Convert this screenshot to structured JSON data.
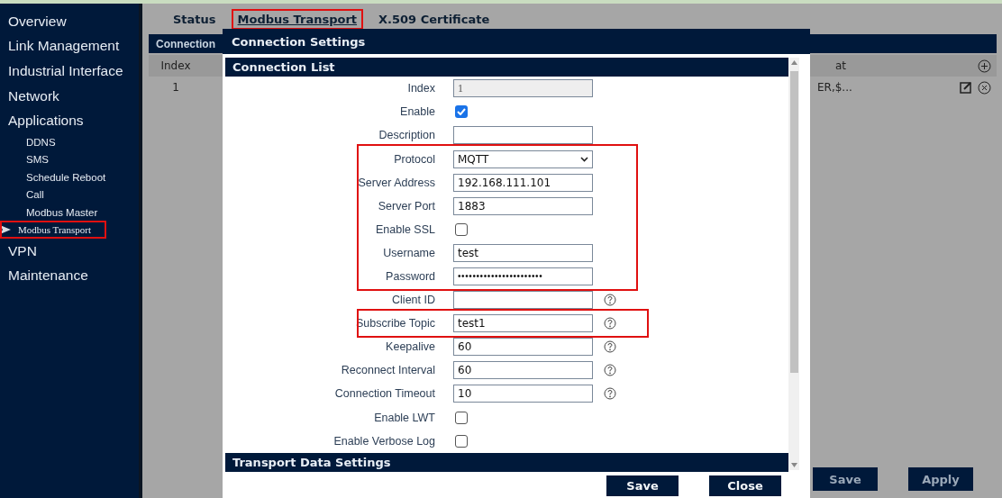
{
  "sidebar": {
    "items": [
      {
        "label": "Overview",
        "selected": false,
        "highlighted": false
      },
      {
        "label": "Link Management",
        "selected": false,
        "highlighted": false
      },
      {
        "label": "Industrial Interface",
        "selected": false,
        "highlighted": false
      },
      {
        "label": "Network",
        "selected": false,
        "highlighted": false
      },
      {
        "label": "Applications",
        "selected": false,
        "highlighted": false,
        "children": [
          {
            "label": "DDNS",
            "selected": false,
            "highlighted": false
          },
          {
            "label": "SMS",
            "selected": false,
            "highlighted": false
          },
          {
            "label": "Schedule Reboot",
            "selected": false,
            "highlighted": false
          },
          {
            "label": "Call",
            "selected": false,
            "highlighted": false
          },
          {
            "label": "Modbus Master",
            "selected": false,
            "highlighted": false
          },
          {
            "label": "Modbus Transport",
            "selected": true,
            "highlighted": true
          }
        ]
      },
      {
        "label": "VPN",
        "selected": false,
        "highlighted": false
      },
      {
        "label": "Maintenance",
        "selected": false,
        "highlighted": false
      }
    ]
  },
  "tabs": [
    {
      "label": "Status",
      "selected": false,
      "highlighted": false
    },
    {
      "label": "Modbus Transport",
      "selected": true,
      "highlighted": true
    },
    {
      "label": "X.509 Certificate",
      "selected": false,
      "highlighted": false
    }
  ],
  "background_table": {
    "title": "Connection",
    "columns": [
      "Index",
      "at"
    ],
    "rows": [
      {
        "cells": [
          "1",
          "ER,$..."
        ]
      }
    ]
  },
  "page_buttons": [
    "Save",
    "Apply"
  ],
  "dialog": {
    "title": "Connection Settings",
    "section": "Connection List",
    "groups": [
      {
        "highlighted": false,
        "rows": [
          {
            "kind": "readonly",
            "label": "Index",
            "value": "1",
            "help": false
          },
          {
            "kind": "checkbox",
            "label": "Enable",
            "checked": true,
            "help": false
          },
          {
            "kind": "text",
            "label": "Description",
            "value": "",
            "help": false
          }
        ]
      },
      {
        "highlighted": true,
        "rows": [
          {
            "kind": "select",
            "label": "Protocol",
            "value": "MQTT",
            "help": false
          },
          {
            "kind": "text",
            "label": "Server Address",
            "value": "192.168.111.101",
            "help": false
          },
          {
            "kind": "text",
            "label": "Server Port",
            "value": "1883",
            "help": false
          },
          {
            "kind": "checkbox",
            "label": "Enable SSL",
            "checked": false,
            "help": false
          },
          {
            "kind": "text",
            "label": "Username",
            "value": "test",
            "help": false
          },
          {
            "kind": "password",
            "label": "Password",
            "value": "•••••••••••••••••••••••",
            "help": false
          }
        ]
      },
      {
        "highlighted": false,
        "rows": [
          {
            "kind": "text",
            "label": "Client ID",
            "value": "",
            "help": true
          }
        ]
      },
      {
        "highlighted": true,
        "rows": [
          {
            "kind": "text",
            "label": "Subscribe Topic",
            "value": "test1",
            "help": true
          }
        ]
      },
      {
        "highlighted": false,
        "rows": [
          {
            "kind": "text",
            "label": "Keepalive",
            "value": "60",
            "help": true
          },
          {
            "kind": "text",
            "label": "Reconnect Interval",
            "value": "60",
            "help": true
          },
          {
            "kind": "text",
            "label": "Connection Timeout",
            "value": "10",
            "help": true
          },
          {
            "kind": "checkbox",
            "label": "Enable LWT",
            "checked": false,
            "help": false
          },
          {
            "kind": "checkbox",
            "label": "Enable Verbose Log",
            "checked": false,
            "help": false
          }
        ]
      }
    ],
    "next_section": "Transport Data Settings",
    "buttons": [
      "Save",
      "Close"
    ]
  }
}
